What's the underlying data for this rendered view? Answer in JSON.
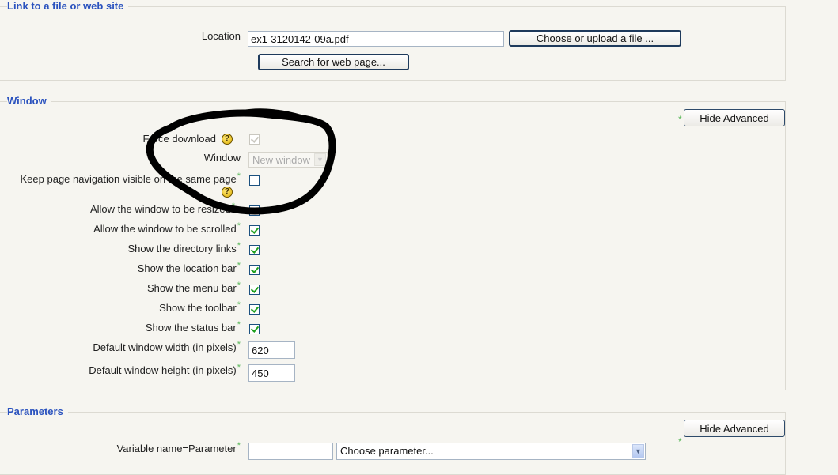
{
  "sections": {
    "link": {
      "legend": "Link to a file or web site",
      "location_label": "Location",
      "location_value": "ex1-3120142-09a.pdf",
      "choose_button": "Choose or upload a file ...",
      "search_button": "Search for web page..."
    },
    "window": {
      "legend": "Window",
      "hide_advanced_button": "Hide Advanced",
      "advanced_marker": "*",
      "force_download_label": "Force download",
      "force_download_checked": true,
      "window_label": "Window",
      "window_select_value": "New window",
      "keep_nav_label": "Keep page navigation visible on the same page",
      "keep_nav_checked": false,
      "options": [
        {
          "label": "Allow the window to be resized",
          "checked": false
        },
        {
          "label": "Allow the window to be scrolled",
          "checked": true
        },
        {
          "label": "Show the directory links",
          "checked": true
        },
        {
          "label": "Show the location bar",
          "checked": true
        },
        {
          "label": "Show the menu bar",
          "checked": true
        },
        {
          "label": "Show the toolbar",
          "checked": true
        },
        {
          "label": "Show the status bar",
          "checked": true
        }
      ],
      "width_label": "Default window width (in pixels)",
      "width_value": "620",
      "height_label": "Default window height (in pixels)",
      "height_value": "450"
    },
    "parameters": {
      "legend": "Parameters",
      "hide_advanced_button": "Hide Advanced",
      "advanced_marker": "*",
      "variable_label": "Variable name=Parameter",
      "variable_value": "",
      "parameter_select_value": "Choose parameter..."
    }
  },
  "annotation": {
    "description": "hand-drawn black circle around Force download / Window / Keep page navigation settings",
    "color": "#000000"
  },
  "colors": {
    "legend": "#2a52be",
    "required_star": "#5cb85c",
    "background": "#f6f5f0"
  }
}
